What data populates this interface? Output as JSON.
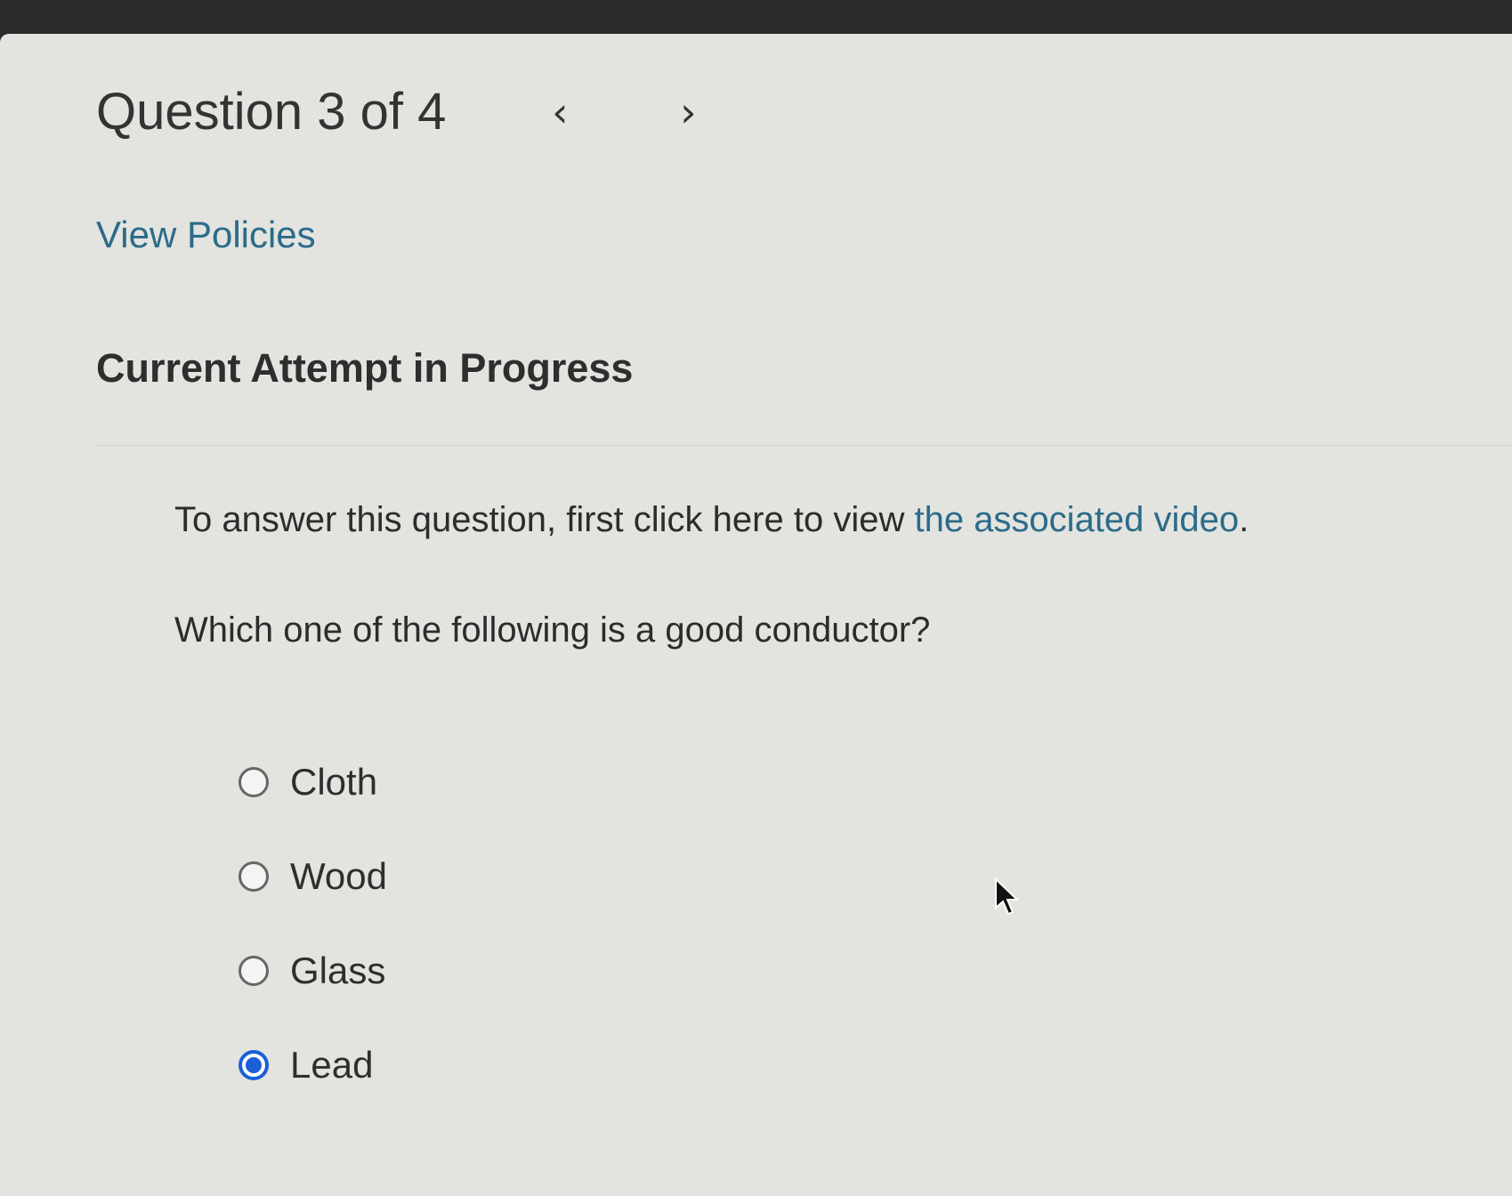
{
  "header": {
    "title": "Question 3 of 4",
    "prev_icon": "chevron-left-icon",
    "next_icon": "chevron-right-icon"
  },
  "links": {
    "view_policies": "View Policies"
  },
  "attempt": {
    "heading": "Current Attempt in Progress"
  },
  "question": {
    "intro_prefix": "To answer this question, first click here to view",
    "video_link": "the associated video",
    "intro_suffix": ".",
    "prompt": "Which one of the following is a good conductor?",
    "options": [
      {
        "label": "Cloth",
        "selected": false
      },
      {
        "label": "Wood",
        "selected": false
      },
      {
        "label": "Glass",
        "selected": false
      },
      {
        "label": "Lead",
        "selected": true
      }
    ]
  },
  "colors": {
    "link": "#2b6b8a",
    "radio_selected": "#1a5fd6",
    "background": "#e3e4df"
  }
}
